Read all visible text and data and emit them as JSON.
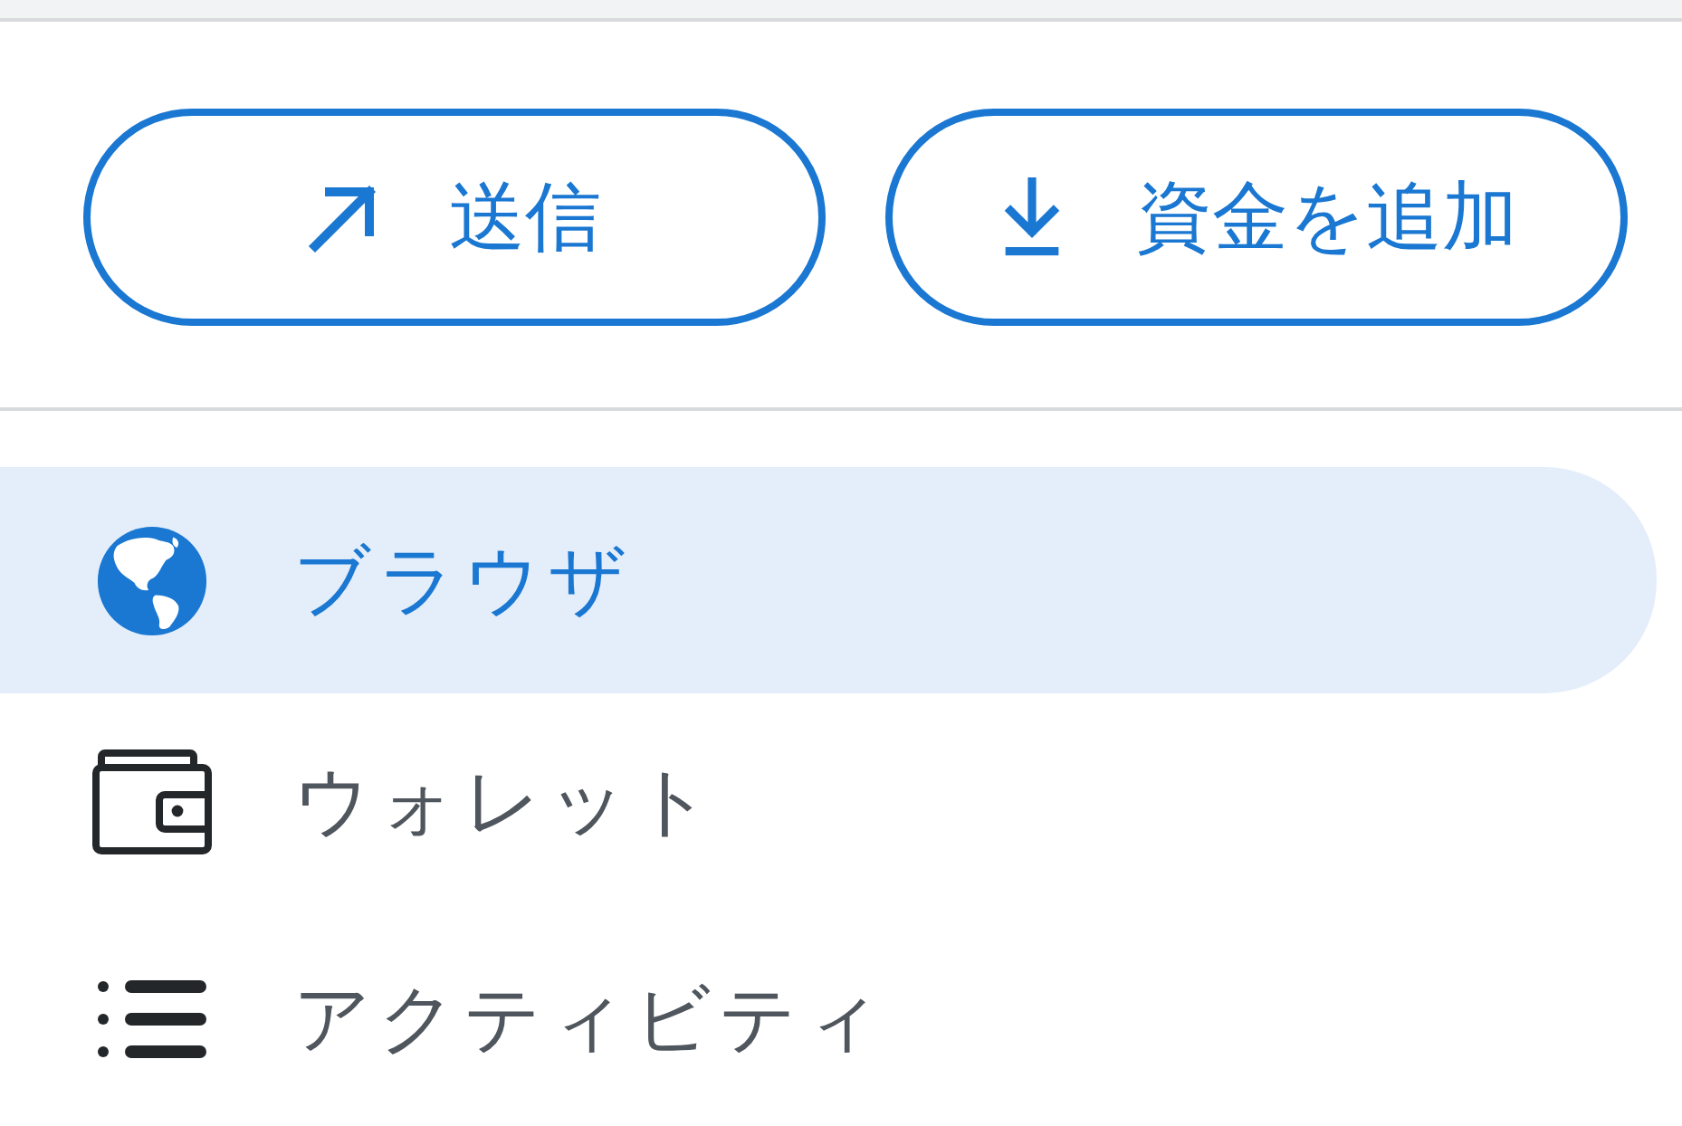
{
  "actions": [
    {
      "kind": "send",
      "label": "送信"
    },
    {
      "kind": "add_funds",
      "label": "資金を追加"
    }
  ],
  "nav": [
    {
      "kind": "browser",
      "label": "ブラウザ",
      "selected": true
    },
    {
      "kind": "wallet",
      "label": "ウォレット",
      "selected": false
    },
    {
      "kind": "activity",
      "label": "アクティビティ",
      "selected": false
    }
  ]
}
